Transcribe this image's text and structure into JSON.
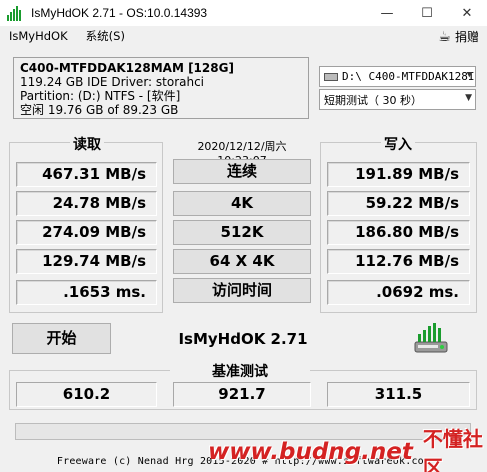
{
  "window": {
    "title": "IsMyHdOK 2.71 - OS:10.0.14393",
    "minimize": "—",
    "maximize": "☐",
    "close": "✕"
  },
  "menu": {
    "items": [
      "IsMyHdOK",
      "系统(S)"
    ],
    "donate_label": "捐赠"
  },
  "info": {
    "line1": "C400-MTFDDAK128MAM [128G]",
    "line2": "119.24 GB  IDE Driver: storahci",
    "line3": "Partition: (D:) NTFS - [软件]",
    "line4": "空闲 19.76 GB of 89.23 GB"
  },
  "selects": {
    "disk": "D:\\ C400-MTFDDAK128I",
    "mode": "短期测试（ 30 秒）"
  },
  "read": {
    "label": "读取",
    "values": [
      "467.31 MB/s",
      "24.78 MB/s",
      "274.09 MB/s",
      "129.74 MB/s",
      ".1653 ms."
    ]
  },
  "write": {
    "label": "写入",
    "values": [
      "191.89 MB/s",
      "59.22 MB/s",
      "186.80 MB/s",
      "112.76 MB/s",
      ".0692 ms."
    ]
  },
  "tests": {
    "datetime": "2020/12/12/周六 10:23:07",
    "labels": [
      "连续",
      "4K",
      "512K",
      "64 X 4K",
      "访问时间"
    ]
  },
  "start_label": "开始",
  "app_name": "IsMyHdOK 2.71",
  "benchmark": {
    "label": "基准测试",
    "values": [
      "610.2",
      "921.7",
      "311.5"
    ]
  },
  "progress": {
    "percent": 0
  },
  "footer": "Freeware (c) Nenad Hrg 2015-2020 # http://www.softwareok.com",
  "watermark": {
    "site": "www.budng.net",
    "brand": "不懂社区"
  },
  "colors": {
    "background": "#f0f0f0",
    "accent_green": "#1a9c2e",
    "watermark_red": "#d42222"
  },
  "icons": {
    "app": "bars-chart-icon",
    "donate": "coffee-cup-icon",
    "drive": "hard-drive-icon",
    "big": "hdd-benchmark-icon"
  }
}
